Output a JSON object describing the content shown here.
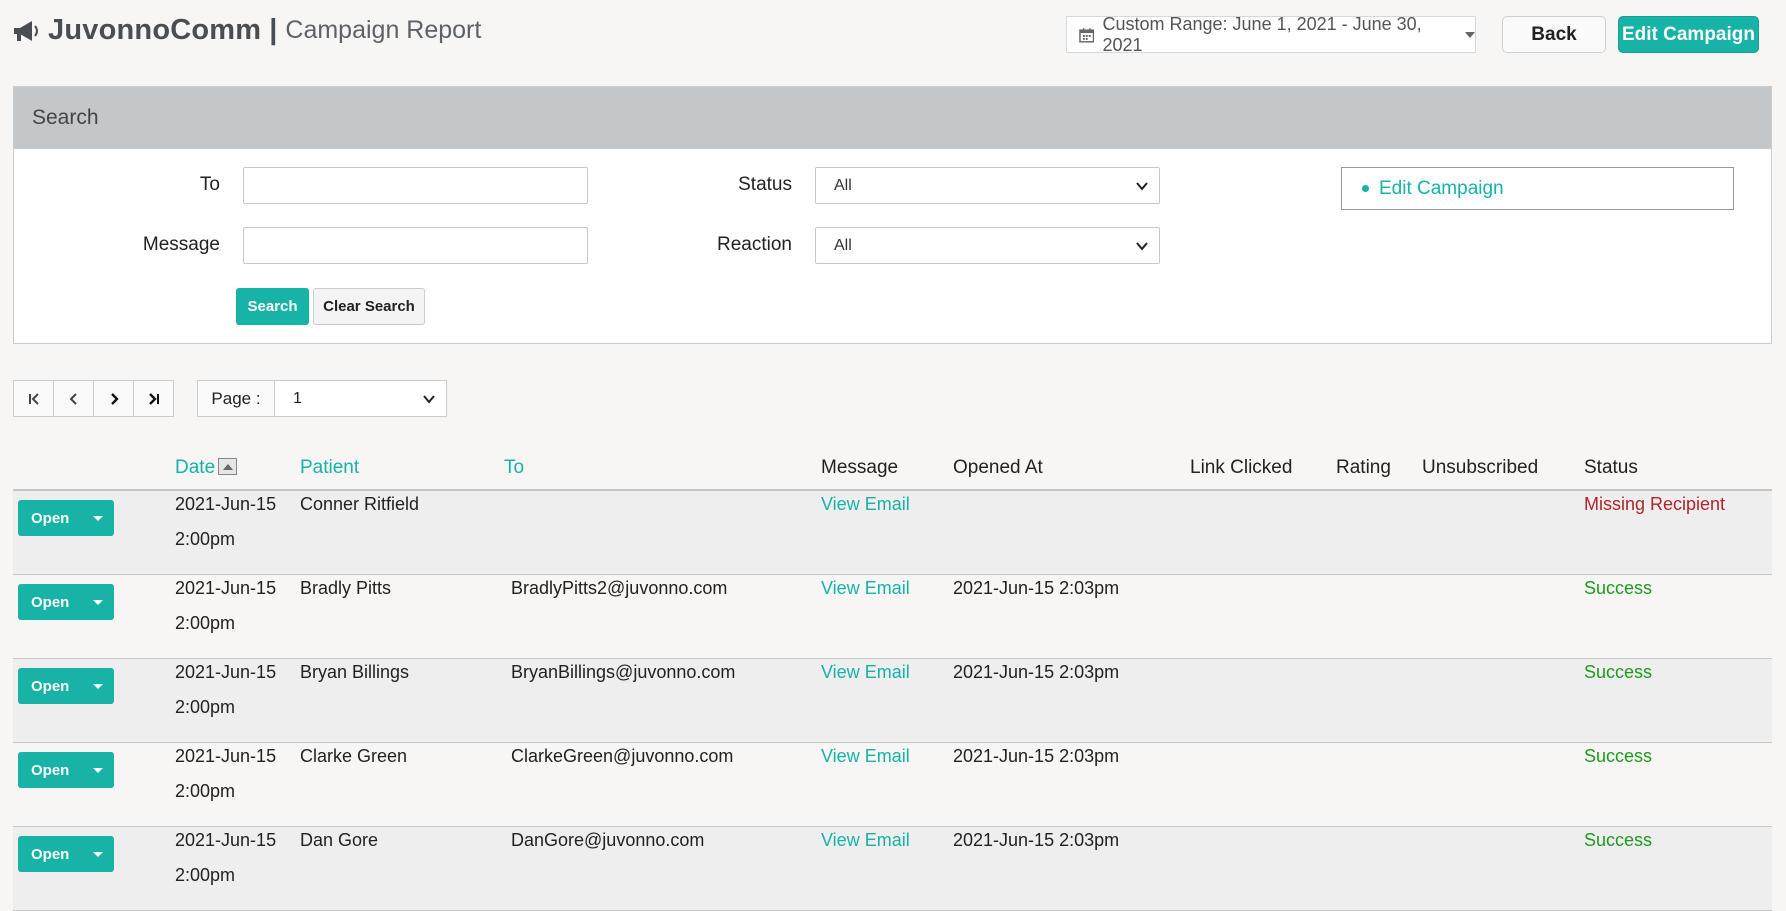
{
  "header": {
    "brand": "JuvonnoComm",
    "separator": "|",
    "subtitle": "Campaign Report",
    "date_range": "Custom Range: June 1, 2021 - June 30, 2021",
    "back_label": "Back",
    "edit_campaign_label": "Edit Campaign"
  },
  "search": {
    "title": "Search",
    "to_label": "To",
    "to_value": "",
    "message_label": "Message",
    "message_value": "",
    "status_label": "Status",
    "status_value": "All",
    "reaction_label": "Reaction",
    "reaction_value": "All",
    "edit_campaign_link": "Edit Campaign",
    "search_button": "Search",
    "clear_button": "Clear Search"
  },
  "pager": {
    "page_label": "Page :",
    "page_value": "1"
  },
  "table": {
    "columns": {
      "date": "Date",
      "patient": "Patient",
      "to": "To",
      "message": "Message",
      "opened_at": "Opened At",
      "link_clicked": "Link Clicked",
      "rating": "Rating",
      "unsubscribed": "Unsubscribed",
      "status": "Status"
    },
    "open_label": "Open",
    "rows": [
      {
        "date": "2021-Jun-15",
        "time": "2:00pm",
        "patient": "Conner Ritfield",
        "to": "",
        "message": "View Email",
        "opened_at": "",
        "link_clicked": "",
        "rating": "",
        "unsubscribed": "",
        "status": "Missing Recipient"
      },
      {
        "date": "2021-Jun-15",
        "time": "2:00pm",
        "patient": "Bradly Pitts",
        "to": "BradlyPitts2@juvonno.com",
        "message": "View Email",
        "opened_at": "2021-Jun-15 2:03pm",
        "link_clicked": "",
        "rating": "",
        "unsubscribed": "",
        "status": "Success"
      },
      {
        "date": "2021-Jun-15",
        "time": "2:00pm",
        "patient": "Bryan Billings",
        "to": "BryanBillings@juvonno.com",
        "message": "View Email",
        "opened_at": "2021-Jun-15 2:03pm",
        "link_clicked": "",
        "rating": "",
        "unsubscribed": "",
        "status": "Success"
      },
      {
        "date": "2021-Jun-15",
        "time": "2:00pm",
        "patient": "Clarke Green",
        "to": "ClarkeGreen@juvonno.com",
        "message": "View Email",
        "opened_at": "2021-Jun-15 2:03pm",
        "link_clicked": "",
        "rating": "",
        "unsubscribed": "",
        "status": "Success"
      },
      {
        "date": "2021-Jun-15",
        "time": "2:00pm",
        "patient": "Dan Gore",
        "to": "DanGore@juvonno.com",
        "message": "View Email",
        "opened_at": "2021-Jun-15 2:03pm",
        "link_clicked": "",
        "rating": "",
        "unsubscribed": "",
        "status": "Success"
      }
    ]
  },
  "colors": {
    "accent": "#16b3a6",
    "error": "#b0242a",
    "success": "#1f9a1f"
  }
}
